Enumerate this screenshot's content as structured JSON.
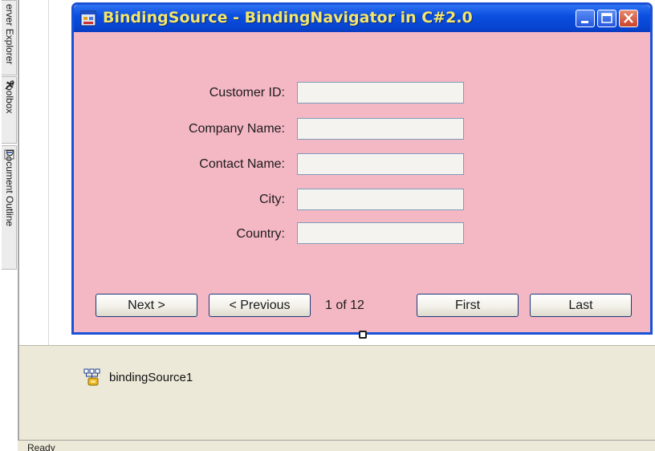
{
  "dock": {
    "tabs": [
      {
        "label": "erver Explorer",
        "icon": "server-icon"
      },
      {
        "label": "Toolbox",
        "icon": "toolbox-icon"
      },
      {
        "label": "Document Outline",
        "icon": "document-outline-icon"
      }
    ]
  },
  "window": {
    "title": "BindingSource - BindingNavigator in C#2.0",
    "title_color": "#f2e66a",
    "titlebar_color": "#0b4fe0",
    "form_background": "#f4b7c4",
    "icon": "form-app-icon"
  },
  "fields": [
    {
      "label": "Customer ID:",
      "value": ""
    },
    {
      "label": "Company Name:",
      "value": ""
    },
    {
      "label": "Contact Name:",
      "value": ""
    },
    {
      "label": "City:",
      "value": ""
    },
    {
      "label": "Country:",
      "value": ""
    }
  ],
  "navigation": {
    "next_label": "Next >",
    "previous_label": "< Previous",
    "position_text": "1 of 12",
    "first_label": "First",
    "last_label": "Last"
  },
  "tray": {
    "component_label": "bindingSource1",
    "icon": "binding-source-icon"
  },
  "status": {
    "text": "Ready"
  }
}
